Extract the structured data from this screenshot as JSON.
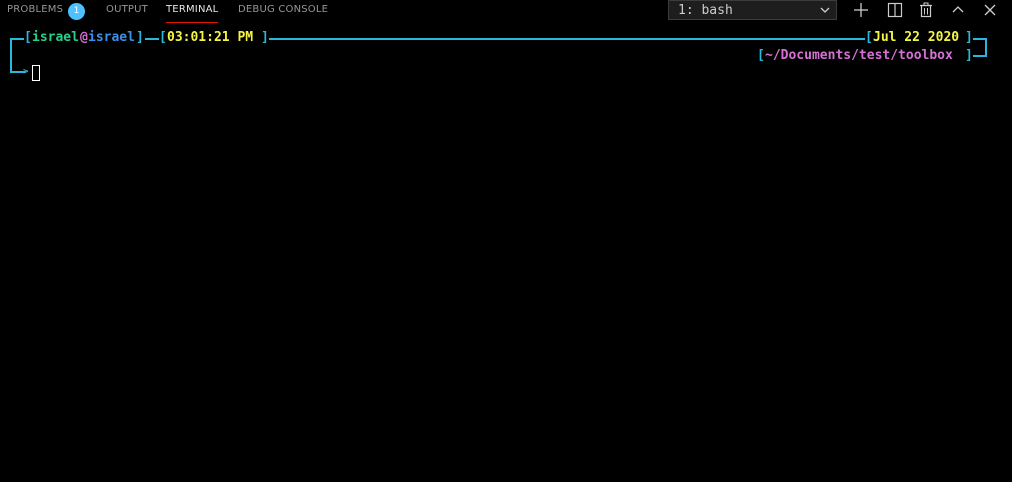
{
  "panel": {
    "tabs": [
      {
        "label": "PROBLEMS",
        "badge": "1"
      },
      {
        "label": "OUTPUT"
      },
      {
        "label": "TERMINAL"
      },
      {
        "label": "DEBUG CONSOLE"
      }
    ],
    "active_tab": "TERMINAL",
    "terminal_select": "1: bash",
    "actions": [
      "plus-icon",
      "split-icon",
      "trash-icon",
      "chevron-up-icon",
      "close-icon"
    ]
  },
  "prompt": {
    "user": "israel",
    "at": "@",
    "host": "israel",
    "time": "03:01:21 PM",
    "date": "Jul 22 2020",
    "cwd": "~/Documents/test/toolbox"
  },
  "colors": {
    "cyan": "#29b8db",
    "green": "#23d18b",
    "magenta": "#d670d6",
    "blue": "#3b8eea",
    "yellow": "#f5f543",
    "tab_active_underline": "#e51400",
    "badge": "#4fc1ff"
  }
}
